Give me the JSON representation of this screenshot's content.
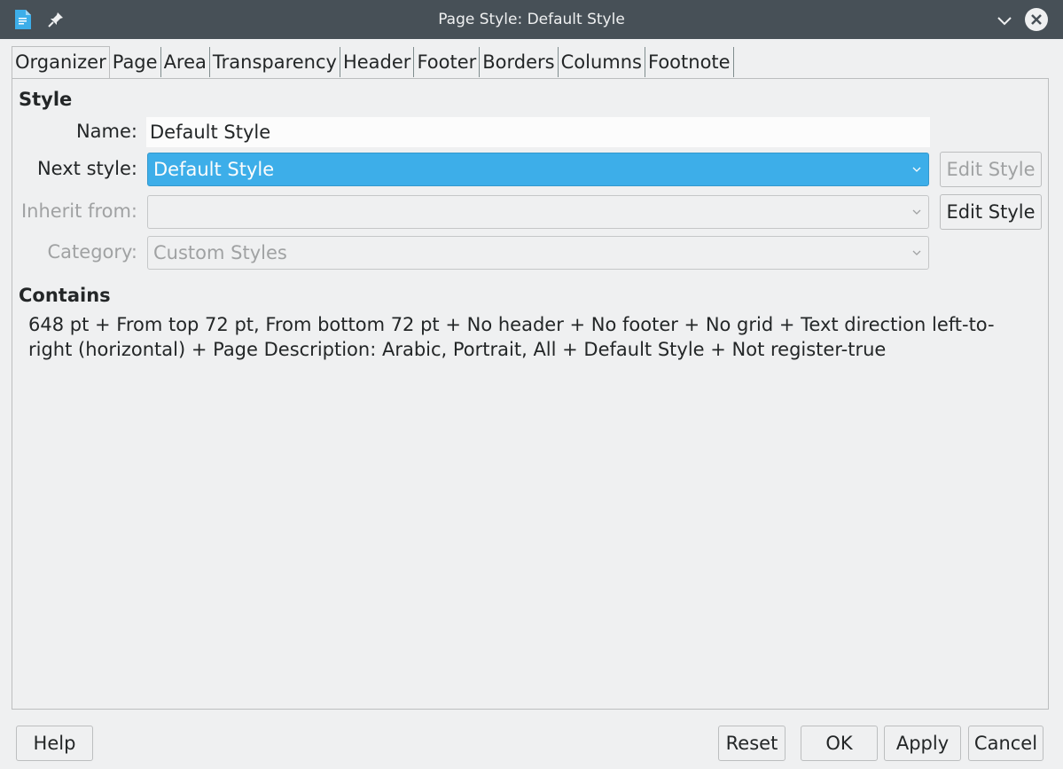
{
  "window": {
    "title": "Page Style: Default Style"
  },
  "tabs": [
    "Organizer",
    "Page",
    "Area",
    "Transparency",
    "Header",
    "Footer",
    "Borders",
    "Columns",
    "Footnote"
  ],
  "active_tab": "Organizer",
  "style_section": {
    "heading": "Style",
    "name_label": "Name:",
    "name_value": "Default Style",
    "next_style_label": "Next style:",
    "next_style_value": "Default Style",
    "inherit_from_label": "Inherit from:",
    "inherit_from_value": "",
    "category_label": "Category:",
    "category_value": "Custom Styles",
    "edit_style_label": "Edit Style"
  },
  "contains_section": {
    "heading": "Contains",
    "text": "648 pt + From top 72 pt, From bottom 72 pt + No header + No footer + No grid + Text direction left-to-right (horizontal) + Page Description: Arabic, Portrait, All + Default Style + Not register-true"
  },
  "buttons": {
    "help": "Help",
    "reset": "Reset",
    "ok": "OK",
    "apply": "Apply",
    "cancel": "Cancel"
  },
  "colors": {
    "titlebar": "#475057",
    "background": "#eff0f1",
    "selection": "#3daee9"
  }
}
